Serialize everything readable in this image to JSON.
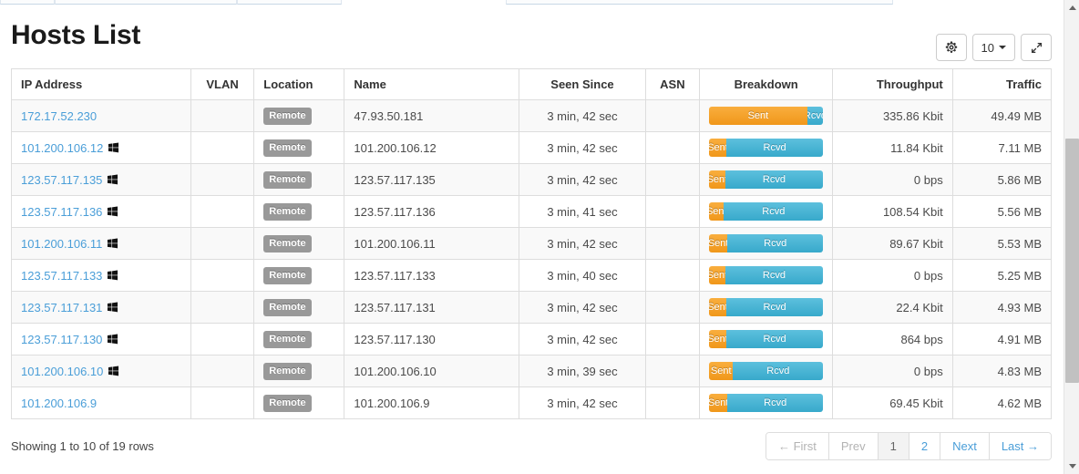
{
  "header": {
    "title": "Hosts List"
  },
  "toolbar": {
    "gear_icon": "gear-icon",
    "page_size": "10",
    "expand_icon": "expand-arrows-icon"
  },
  "table": {
    "columns": [
      "IP Address",
      "VLAN",
      "Location",
      "Name",
      "Seen Since",
      "ASN",
      "Breakdown",
      "Throughput",
      "Traffic"
    ],
    "breakdown_labels": {
      "sent": "Sent",
      "rcvd": "Rcvd"
    },
    "colors": {
      "sent": "#f0971a",
      "rcvd": "#37a9cb",
      "link": "#4a9ed8",
      "badge": "#999999"
    },
    "rows": [
      {
        "ip": "172.17.52.230",
        "os_icon": "",
        "vlan": "",
        "location": "Remote",
        "name": "47.93.50.181",
        "seen_since": "3 min, 42 sec",
        "asn": "",
        "sent_pct": 86,
        "rcvd_pct": 14,
        "throughput": "335.86 Kbit",
        "traffic": "49.49 MB"
      },
      {
        "ip": "101.200.106.12",
        "os_icon": "windows-icon",
        "vlan": "",
        "location": "Remote",
        "name": "101.200.106.12",
        "seen_since": "3 min, 42 sec",
        "asn": "",
        "sent_pct": 15,
        "rcvd_pct": 85,
        "throughput": "11.84 Kbit",
        "traffic": "7.11 MB"
      },
      {
        "ip": "123.57.117.135",
        "os_icon": "windows-icon",
        "vlan": "",
        "location": "Remote",
        "name": "123.57.117.135",
        "seen_since": "3 min, 42 sec",
        "asn": "",
        "sent_pct": 14,
        "rcvd_pct": 86,
        "throughput": "0 bps",
        "traffic": "5.86 MB"
      },
      {
        "ip": "123.57.117.136",
        "os_icon": "windows-icon",
        "vlan": "",
        "location": "Remote",
        "name": "123.57.117.136",
        "seen_since": "3 min, 41 sec",
        "asn": "",
        "sent_pct": 13,
        "rcvd_pct": 87,
        "throughput": "108.54 Kbit",
        "traffic": "5.56 MB"
      },
      {
        "ip": "101.200.106.11",
        "os_icon": "windows-icon",
        "vlan": "",
        "location": "Remote",
        "name": "101.200.106.11",
        "seen_since": "3 min, 42 sec",
        "asn": "",
        "sent_pct": 16,
        "rcvd_pct": 84,
        "throughput": "89.67 Kbit",
        "traffic": "5.53 MB"
      },
      {
        "ip": "123.57.117.133",
        "os_icon": "windows-icon",
        "vlan": "",
        "location": "Remote",
        "name": "123.57.117.133",
        "seen_since": "3 min, 40 sec",
        "asn": "",
        "sent_pct": 14,
        "rcvd_pct": 86,
        "throughput": "0 bps",
        "traffic": "5.25 MB"
      },
      {
        "ip": "123.57.117.131",
        "os_icon": "windows-icon",
        "vlan": "",
        "location": "Remote",
        "name": "123.57.117.131",
        "seen_since": "3 min, 42 sec",
        "asn": "",
        "sent_pct": 15,
        "rcvd_pct": 85,
        "throughput": "22.4 Kbit",
        "traffic": "4.93 MB"
      },
      {
        "ip": "123.57.117.130",
        "os_icon": "windows-icon",
        "vlan": "",
        "location": "Remote",
        "name": "123.57.117.130",
        "seen_since": "3 min, 42 sec",
        "asn": "",
        "sent_pct": 15,
        "rcvd_pct": 85,
        "throughput": "864 bps",
        "traffic": "4.91 MB"
      },
      {
        "ip": "101.200.106.10",
        "os_icon": "windows-icon",
        "vlan": "",
        "location": "Remote",
        "name": "101.200.106.10",
        "seen_since": "3 min, 39 sec",
        "asn": "",
        "sent_pct": 21,
        "rcvd_pct": 79,
        "throughput": "0 bps",
        "traffic": "4.83 MB"
      },
      {
        "ip": "101.200.106.9",
        "os_icon": "",
        "vlan": "",
        "location": "Remote",
        "name": "101.200.106.9",
        "seen_since": "3 min, 42 sec",
        "asn": "",
        "sent_pct": 16,
        "rcvd_pct": 84,
        "throughput": "69.45 Kbit",
        "traffic": "4.62 MB"
      }
    ]
  },
  "footer": {
    "showing": "Showing 1 to 10 of 19 rows",
    "pagination": [
      {
        "label": "← First",
        "state": "disabled"
      },
      {
        "label": "Prev",
        "state": "disabled"
      },
      {
        "label": "1",
        "state": "active"
      },
      {
        "label": "2",
        "state": "link"
      },
      {
        "label": "Next",
        "state": "link"
      },
      {
        "label": "Last →",
        "state": "link"
      }
    ]
  }
}
